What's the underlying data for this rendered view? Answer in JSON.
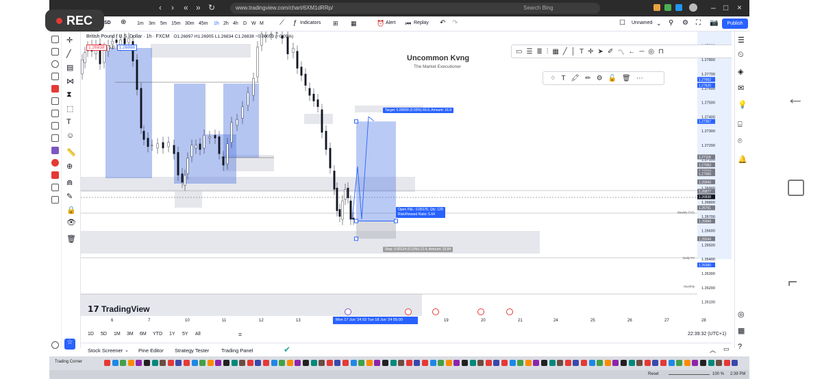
{
  "recording": {
    "label": "REC"
  },
  "browser": {
    "url": "www.tradingview.com/chart/6XM1dRRp/",
    "search_placeholder": "Search Bing"
  },
  "toolbar": {
    "symbol_suffix": "SD",
    "timeframes": [
      "1m",
      "3m",
      "5m",
      "15m",
      "30m",
      "45m",
      "1h",
      "2h",
      "4h",
      "D",
      "W",
      "M"
    ],
    "active_timeframe": "1h",
    "indicators_label": "Indicators",
    "alert_label": "Alert",
    "replay_label": "Replay",
    "layout_name": "Unnamed",
    "publish_label": "Publish"
  },
  "legend": {
    "symbol": "British Pound / U.S. Dollar · 1h · FXCM",
    "ohlc": "O1.26897 H1.26905 L1.26834 C1.26838 −0.00059 (−0.05%)",
    "sell_price": "1.26838",
    "spread": "5.0",
    "buy_price": "1.26888"
  },
  "watermark": {
    "title": "Uncommon Kvng",
    "subtitle": "The Market Executioner"
  },
  "position": {
    "target_label": "Target: 0.00699 (0.55%) 69.9, Amount: 16.9",
    "open_pl_label": "Open P&L: 0.00176, Qty: 129",
    "rr_label": "Risk/Reward Ratio: 5.64",
    "stop_label": "Stop: 0.00124 (0.10%) 12.4, Amount: 15.84"
  },
  "brand": {
    "logo_text": "TradingView"
  },
  "chart_data": {
    "type": "candlestick",
    "symbol": "GBPUSD",
    "timeframe": "1h",
    "y_ticks": [
      "1.27900",
      "1.27800",
      "1.27700",
      "1.27600",
      "1.27500",
      "1.27400",
      "1.27300",
      "1.27200",
      "1.27100",
      "1.27000",
      "1.26900",
      "1.26800",
      "1.26700",
      "1.26600",
      "1.26500",
      "1.26400",
      "1.26300",
      "1.26200",
      "1.26100"
    ],
    "y_range": [
      1.2605,
      1.2795
    ],
    "x_ticks": [
      "6",
      "7",
      "10",
      "11",
      "12",
      "13",
      "14",
      "19",
      "20",
      "21",
      "24",
      "25",
      "26",
      "27",
      "28"
    ],
    "price_tags": [
      {
        "value": "1.27662",
        "color": "#2962ff"
      },
      {
        "value": "1.27621",
        "color": "#2962ff"
      },
      {
        "value": "1.27620",
        "color": "#2962ff"
      },
      {
        "value": "1.27367",
        "color": "#2962ff"
      },
      {
        "value": "1.27118",
        "color": "#787b86"
      },
      {
        "value": "1.27063",
        "color": "#787b86"
      },
      {
        "value": "1.27019",
        "color": "#787b86"
      },
      {
        "value": "1.27000",
        "color": "#787b86"
      },
      {
        "value": "1.26943",
        "color": "#787b86"
      },
      {
        "value": "1.26877",
        "color": "#787b86"
      },
      {
        "value": "1.26838",
        "color": "#131722"
      },
      {
        "value": "1.26761",
        "color": "#787b86"
      },
      {
        "value": "1.26668",
        "color": "#787b86"
      },
      {
        "value": "1.26544",
        "color": "#787b86"
      },
      {
        "value": "1.26360",
        "color": "#2962ff"
      }
    ],
    "level_labels": [
      {
        "text": "Weekly FVG",
        "value": 1.2673
      },
      {
        "text": "Daily FV",
        "value": 1.2641
      },
      {
        "text": "Monthly",
        "value": 1.2621
      }
    ],
    "crosshair_time": "Mon 17 Jun '24   03   Tue 18 Jun '24   05:00",
    "long_position": {
      "entry": 1.26668,
      "target": 1.27367,
      "stop": 1.26544
    }
  },
  "range_bar": {
    "ranges": [
      "1D",
      "5D",
      "1M",
      "3M",
      "6M",
      "YTD",
      "1Y",
      "5Y",
      "All"
    ],
    "clock": "22:39:32 (UTC+1)"
  },
  "bottom_panel": {
    "tabs": [
      "Stock Screener",
      "Pine Editor",
      "Strategy Tester",
      "Trading Panel"
    ]
  },
  "taskbar": {
    "app_label": "Trading Corner"
  },
  "sysbar": {
    "zoom": "100 %",
    "clock": "2:39 PM",
    "reset": "Reset"
  }
}
